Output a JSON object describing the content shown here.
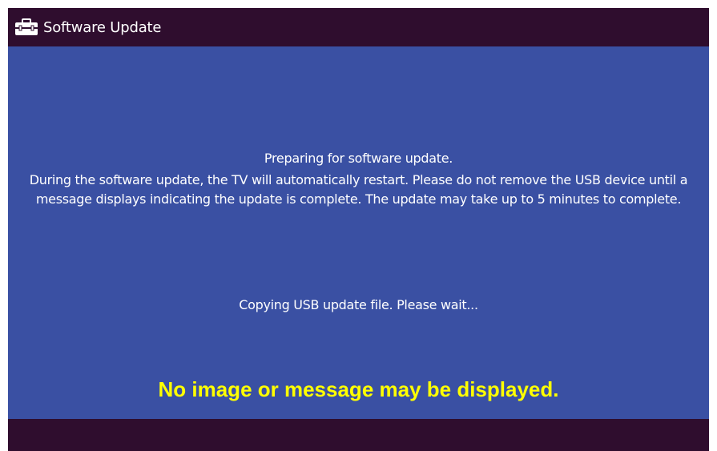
{
  "window": {
    "title": "Software Update",
    "icon": "toolbox-icon"
  },
  "message": {
    "title": "Preparing for software update.",
    "body": "During the software update, the TV will automatically restart. Please do not remove the USB device until a message displays indicating the update is complete. The update may take up to 5 minutes to complete.",
    "status": "Copying USB update file. Please wait..."
  },
  "note": {
    "text": "No image or message may be displayed.",
    "color": "#ffff00"
  },
  "colors": {
    "bar": "#2f0d2e",
    "panel": "#3a50a3",
    "text": "#ffffff"
  }
}
